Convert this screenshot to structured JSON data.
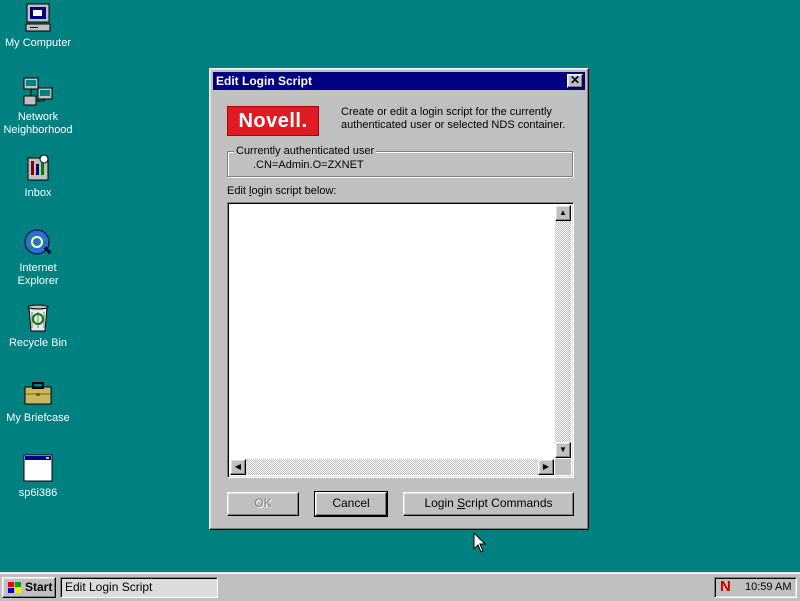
{
  "desktop": {
    "icons": [
      {
        "label": "My Computer",
        "icon": "computer-icon"
      },
      {
        "label": "Network Neighborhood",
        "icon": "network-icon"
      },
      {
        "label": "Inbox",
        "icon": "inbox-icon"
      },
      {
        "label": "Internet Explorer",
        "icon": "internet-explorer-icon"
      },
      {
        "label": "Recycle Bin",
        "icon": "recycle-bin-icon"
      },
      {
        "label": "My Briefcase",
        "icon": "briefcase-icon"
      },
      {
        "label": "sp6i386",
        "icon": "program-window-icon"
      }
    ]
  },
  "dialog": {
    "title": "Edit Login Script",
    "close": "✕",
    "logo_text": "Novell.",
    "intro": "Create or edit a login script for the currently authenticated user or selected NDS container.",
    "user_group_label": "Currently authenticated user",
    "user_value": ".CN=Admin.O=ZXNET",
    "edit_label_pre": "Edit ",
    "edit_label_u": "l",
    "edit_label_post": "ogin script below:",
    "script_text": "",
    "ok_label": "OK",
    "cancel_label": "Cancel",
    "commands_pre": "Login ",
    "commands_u": "S",
    "commands_post": "cript Commands"
  },
  "taskbar": {
    "start_label": "Start",
    "task_label": "Edit Login Script",
    "tray_icon": "novell-n-icon",
    "tray_n": "N",
    "clock": "10:59 AM"
  },
  "colors": {
    "desktop": "#008080",
    "titlebar": "#000080",
    "novell_red": "#e11b22"
  }
}
